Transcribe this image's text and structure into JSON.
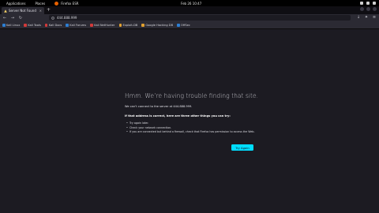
{
  "topbar": {
    "applications": "Applications",
    "places": "Places",
    "app_name": "Firefox ESR",
    "clock": "Feb 26  10:47"
  },
  "tab": {
    "title": "Server Not Found",
    "close": "×",
    "new_tab": "+"
  },
  "navbar": {
    "back": "←",
    "forward": "→",
    "reload": "↻",
    "url": "444.888.999"
  },
  "bookmarks": [
    {
      "label": "Kali Linux",
      "color": "#2d7fd3"
    },
    {
      "label": "Kali Tools",
      "color": "#d23a3a"
    },
    {
      "label": "Kali Docs",
      "color": "#d23a3a"
    },
    {
      "label": "Kali Forums",
      "color": "#2d7fd3"
    },
    {
      "label": "Kali NetHunter",
      "color": "#d23a3a"
    },
    {
      "label": "Exploit-DB",
      "color": "#e0a030"
    },
    {
      "label": "Google Hacking DB",
      "color": "#e0a030"
    },
    {
      "label": "OffSec",
      "color": "#2d7fd3"
    }
  ],
  "error": {
    "title": "Hmm. We’re having trouble finding that site.",
    "description": "We can’t connect to the server at 444.888.999.",
    "subtitle": "If that address is correct, here are three other things you can try:",
    "suggestions": [
      "Try again later.",
      "Check your network connection.",
      "If you are connected but behind a firewall, check that Firefox has permission to access the Web."
    ],
    "button": "Try Again"
  },
  "colors": {
    "accent": "#00ddff",
    "background": "#1c1b22",
    "toolbar": "#2b2a33"
  }
}
